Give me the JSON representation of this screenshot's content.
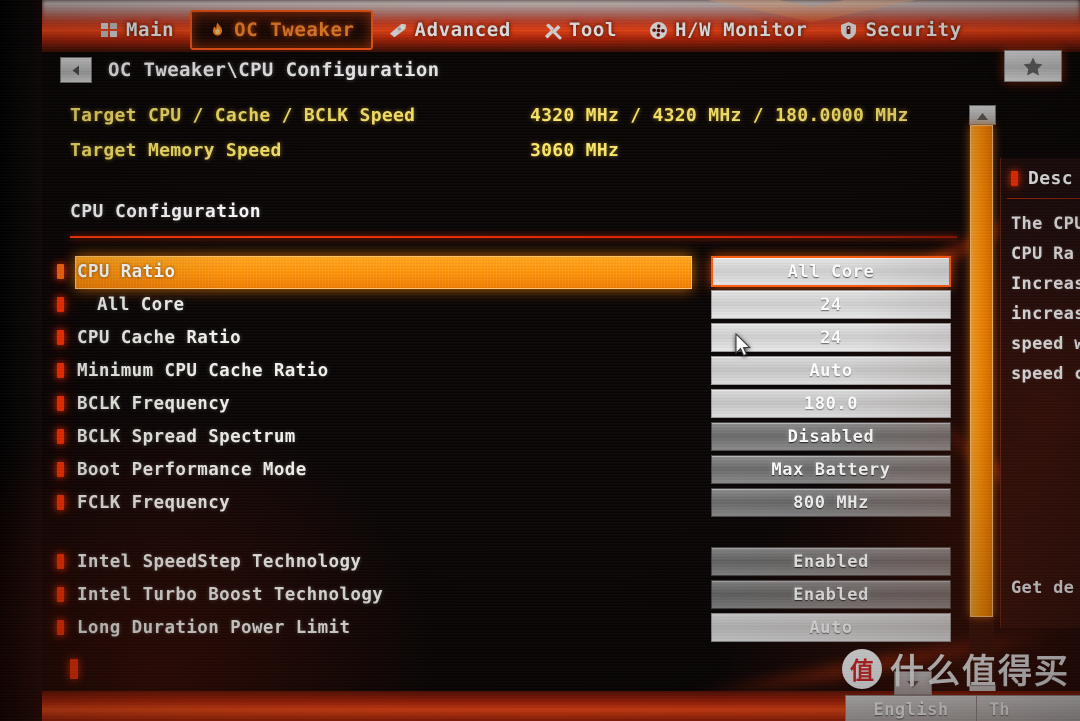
{
  "topbar": {
    "tabs": [
      {
        "label": "Main",
        "icon": "grid-icon",
        "active": false
      },
      {
        "label": "OC Tweaker",
        "icon": "flame-icon",
        "active": true
      },
      {
        "label": "Advanced",
        "icon": "rocket-icon",
        "active": false
      },
      {
        "label": "Tool",
        "icon": "wrench-icon",
        "active": false
      },
      {
        "label": "H/W Monitor",
        "icon": "fan-icon",
        "active": false
      },
      {
        "label": "Security",
        "icon": "shield-icon",
        "active": false
      }
    ],
    "favorite_icon": "star-icon"
  },
  "breadcrumb": {
    "back_icon": "left-triangle-icon",
    "path": "OC Tweaker\\CPU Configuration"
  },
  "targets": [
    {
      "label": "Target CPU / Cache / BCLK Speed",
      "value": "4320 MHz / 4320 MHz / 180.0000 MHz"
    },
    {
      "label": "Target Memory Speed",
      "value": "3060 MHz"
    }
  ],
  "section": {
    "title": "CPU Configuration"
  },
  "settings": [
    {
      "label": "CPU Ratio",
      "value": "All Core",
      "selected": true,
      "indent": false,
      "gap": false,
      "value_style": "active"
    },
    {
      "label": "All Core",
      "value": "24",
      "selected": false,
      "indent": true,
      "gap": false,
      "value_style": "light"
    },
    {
      "label": "CPU Cache Ratio",
      "value": "24",
      "selected": false,
      "indent": false,
      "gap": false,
      "value_style": "light"
    },
    {
      "label": "Minimum CPU Cache Ratio",
      "value": "Auto",
      "selected": false,
      "indent": false,
      "gap": false,
      "value_style": "lighter"
    },
    {
      "label": "BCLK Frequency",
      "value": "180.0",
      "selected": false,
      "indent": false,
      "gap": false,
      "value_style": "lighter"
    },
    {
      "label": "BCLK Spread Spectrum",
      "value": "Disabled",
      "selected": false,
      "indent": false,
      "gap": false,
      "value_style": "dark"
    },
    {
      "label": "Boot Performance Mode",
      "value": "Max Battery",
      "selected": false,
      "indent": false,
      "gap": false,
      "value_style": "dark"
    },
    {
      "label": "FCLK Frequency",
      "value": "800 MHz",
      "selected": false,
      "indent": false,
      "gap": false,
      "value_style": "dark"
    },
    {
      "label": "Intel SpeedStep Technology",
      "value": "Enabled",
      "selected": false,
      "indent": false,
      "gap": true,
      "value_style": "dark"
    },
    {
      "label": "Intel Turbo Boost Technology",
      "value": "Enabled",
      "selected": false,
      "indent": false,
      "gap": false,
      "value_style": "dark"
    },
    {
      "label": "Long Duration Power Limit",
      "value": "Auto",
      "selected": false,
      "indent": false,
      "gap": false,
      "value_style": "light"
    }
  ],
  "description": {
    "title": "Desc",
    "lines": [
      "The CPU",
      "CPU Ra",
      "Increas",
      "increas",
      "speed w",
      "speed c"
    ],
    "footer": "Get de"
  },
  "scrollbar": {
    "up_icon": "triangle-up-icon",
    "down_icon": "triangle-down-icon"
  },
  "bottombar": {
    "language": "English",
    "next_label": "Th",
    "dropdown_icon": "triangle-down-icon"
  },
  "watermark": {
    "logo_char": "值",
    "text": "什么值得买"
  },
  "colors": {
    "accent_orange": "#ff8a00",
    "accent_red": "#ff3000",
    "bar_red": "#ff4a17",
    "target_yellow": "#ffe96b",
    "text_white": "#f4f4ee"
  }
}
